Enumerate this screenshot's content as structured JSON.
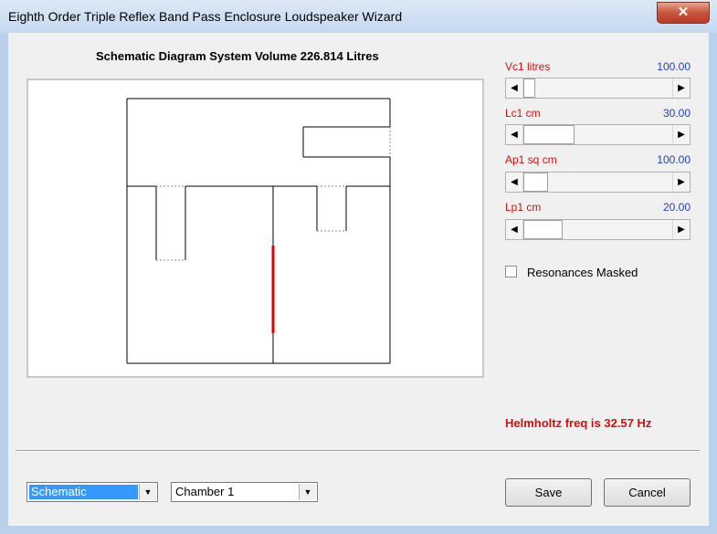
{
  "window": {
    "title": "Eighth Order Triple Reflex Band Pass Enclosure Loudspeaker Wizard",
    "close_glyph": "✕"
  },
  "diagram": {
    "heading": "Schematic Diagram   System Volume 226.814 Litres"
  },
  "params": [
    {
      "name": "Vc1  litres",
      "value": "100.00"
    },
    {
      "name": "Lc1  cm",
      "value": "30.00"
    },
    {
      "name": "Ap1  sq cm",
      "value": "100.00"
    },
    {
      "name": "Lp1  cm",
      "value": "20.00"
    }
  ],
  "scroll_glyphs": {
    "left": "◀",
    "right": "▶",
    "down": "▼"
  },
  "options": {
    "resonances_masked_label": "Resonances Masked",
    "resonances_masked_checked": false
  },
  "status": {
    "helmholtz": "Helmholtz freq is 32.57 Hz"
  },
  "footer": {
    "view_select": "Schematic",
    "chamber_select": "Chamber 1",
    "save_label": "Save",
    "cancel_label": "Cancel"
  }
}
